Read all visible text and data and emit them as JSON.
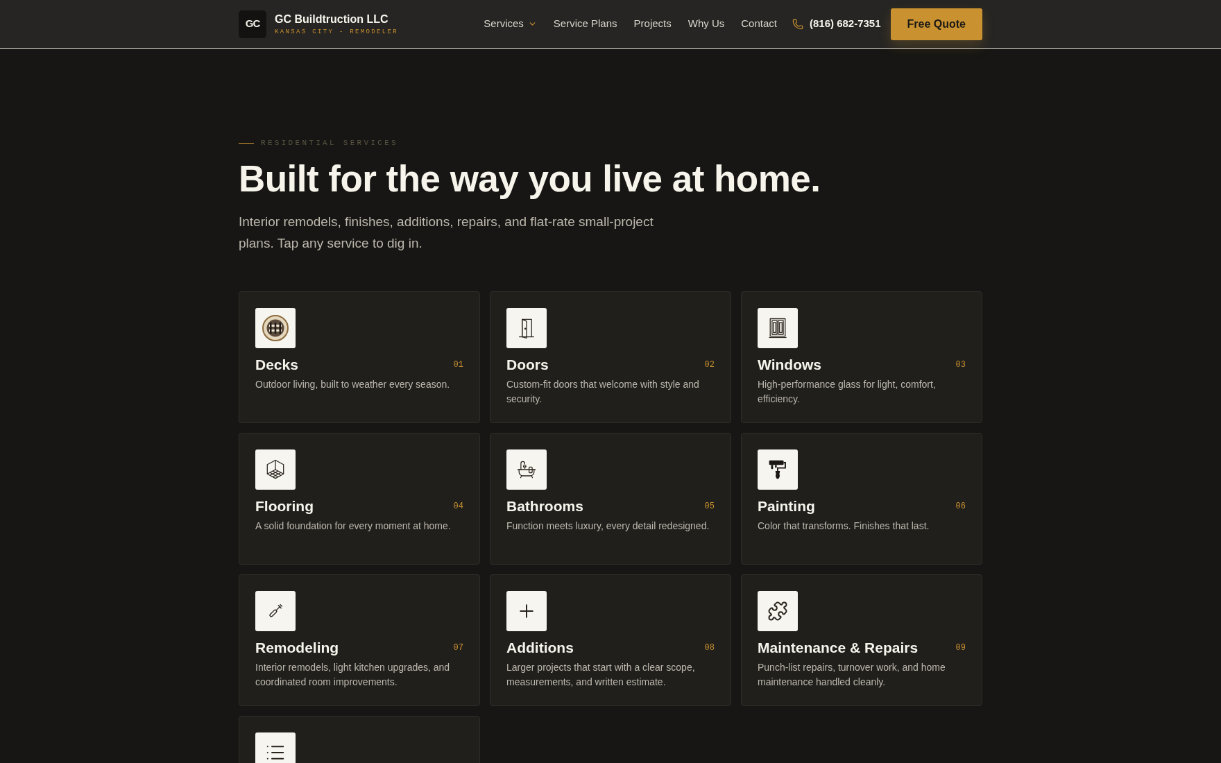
{
  "header": {
    "logo": {
      "mark": "GC",
      "name": "GC Buildtruction LLC",
      "tagline": "KANSAS CITY - REMODELER"
    },
    "nav": [
      {
        "label": "Services",
        "has_menu": true
      },
      {
        "label": "Service Plans",
        "has_menu": false
      },
      {
        "label": "Projects",
        "has_menu": false
      },
      {
        "label": "Why Us",
        "has_menu": false
      },
      {
        "label": "Contact",
        "has_menu": false
      }
    ],
    "phone": "(816) 682-7351",
    "cta": "Free Quote"
  },
  "hero": {
    "eyebrow": "RESIDENTIAL SERVICES",
    "title": "Built for the way you live at home.",
    "intro": "Interior remodels, finishes, additions, repairs, and flat-rate small-project plans. Tap any service to dig in."
  },
  "services": [
    {
      "number": "01",
      "title": "Decks",
      "description": "Outdoor living, built to weather every season."
    },
    {
      "number": "02",
      "title": "Doors",
      "description": "Custom-fit doors that welcome with style and security."
    },
    {
      "number": "03",
      "title": "Windows",
      "description": "High-performance glass for light, comfort, efficiency."
    },
    {
      "number": "04",
      "title": "Flooring",
      "description": "A solid foundation for every moment at home."
    },
    {
      "number": "05",
      "title": "Bathrooms",
      "description": "Function meets luxury, every detail redesigned."
    },
    {
      "number": "06",
      "title": "Painting",
      "description": "Color that transforms. Finishes that last."
    },
    {
      "number": "07",
      "title": "Remodeling",
      "description": "Interior remodels, light kitchen upgrades, and coordinated room improvements."
    },
    {
      "number": "08",
      "title": "Additions",
      "description": "Larger projects that start with a clear scope, measurements, and written estimate."
    },
    {
      "number": "09",
      "title": "Maintenance & Repairs",
      "description": "Punch-list repairs, turnover work, and home maintenance handled cleanly."
    }
  ],
  "more_services_below": true
}
